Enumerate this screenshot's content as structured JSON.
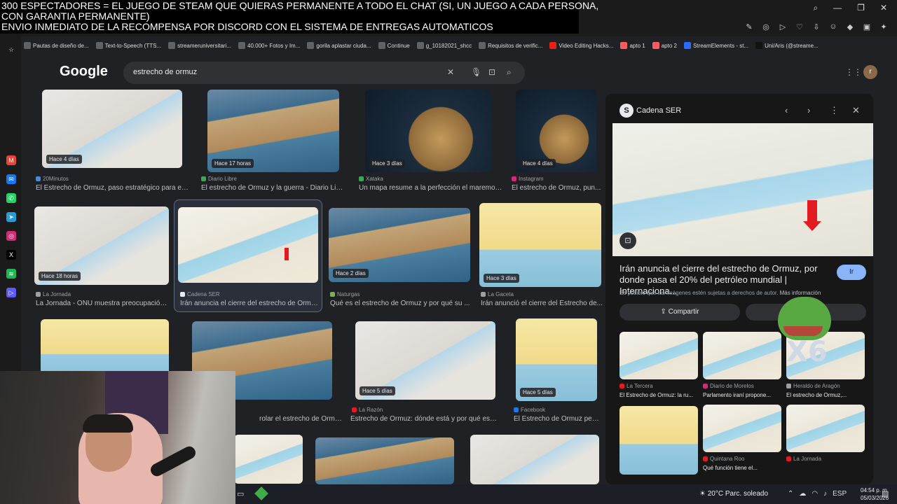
{
  "overlay": {
    "line1": "300 ESPECTADORES = EL JUEGO DE STEAM QUE QUIERAS PERMANENTE A TODO EL CHAT (SI, UN JUEGO A CADA PERSONA,",
    "line2": "CON GARANTIA PERMANENTE)",
    "line3": "ENVIO INMEDIATO DE LA RECOMPENSA POR DISCORD CON EL SISTEMA DE ENTREGAS AUTOMATICOS"
  },
  "bookmarks": [
    "Pautas de diseño de...",
    "Text-to-Speech (TTS...",
    "streameruniversitari...",
    "40.000+ Fotos y Im...",
    "gorila aplastar ciuda...",
    "Continue",
    "g_10182021_shcc",
    "Requisitos de verific...",
    "Video Editing Hacks...",
    "apto 1",
    "apto 2",
    "StreamElements - st...",
    "Uni/Aris (@streame..."
  ],
  "google": {
    "logo": "Google",
    "query": "estrecho de ormuz"
  },
  "results": [
    {
      "badge": "Hace 4 días",
      "source": "20Minutos",
      "title": "El Estrecho de Ormuz, paso estratégico para el ..."
    },
    {
      "badge": "Hace 17 horas",
      "source": "Diario Libre",
      "title": "El estrecho de Ormuz y la guerra - Diario Libre"
    },
    {
      "badge": "Hace 3 días",
      "source": "Xataka",
      "title": "Un mapa resume a la perfección el maremot..."
    },
    {
      "badge": "Hace 4 días",
      "source": "Instagram",
      "title": "El estrecho de Ormuz, pun..."
    },
    {
      "badge": "Hace 18 horas",
      "source": "La Jornada",
      "title": "La Jornada - ONU muestra preocupación..."
    },
    {
      "badge": "",
      "source": "Cadena SER",
      "title": "Irán anuncia el cierre del estrecho de Ormu..."
    },
    {
      "badge": "Hace 2 días",
      "source": "Naturgas",
      "title": "Qué es el estrecho de Ormuz y por qué su ..."
    },
    {
      "badge": "Hace 3 días",
      "source": "La Gaceta",
      "title": "Irán anunció el cierre del Estrecho de..."
    },
    {
      "badge": "",
      "source": "",
      "title": ""
    },
    {
      "badge": "",
      "source": "",
      "title": "rolar el estrecho de Ormuz y se ..."
    },
    {
      "badge": "Hace 5 días",
      "source": "La Razón",
      "title": "Estrecho de Ormuz: dónde está y por qué es un..."
    },
    {
      "badge": "Hace 5 días",
      "source": "Facebook",
      "title": "El Estrecho de Ormuz per..."
    }
  ],
  "panel": {
    "source": "Cadena SER",
    "title": "Irán anuncia el cierre del estrecho de Ormuz, por donde pasa el 20% del petróleo mundial | Internaciona...",
    "visit": "Ir",
    "note": "Es posible que las imágenes estén sujetas a derechos de autor.",
    "more": "Más información",
    "share": "Compartir",
    "related": [
      {
        "source": "La Tercera",
        "title": "El Estrecho de Ormuz: la ru..."
      },
      {
        "source": "Diario de Morelos",
        "title": "Parlamento iraní propone..."
      },
      {
        "source": "Heraldo de Aragón",
        "title": "El estrecho de Ormuz,..."
      },
      {
        "source": "",
        "title": ""
      },
      {
        "source": "Quintana Roo",
        "title": "Qué función tiene el..."
      },
      {
        "source": "La Jornada",
        "title": ""
      }
    ]
  },
  "sticker": {
    "multiplier": "X6"
  },
  "taskbar": {
    "weather": "20°C  Parc. soleado",
    "lang": "ESP",
    "time": "04:54 p. m.",
    "date": "05/03/2026"
  },
  "colors": {
    "accent": "#8ab4f8",
    "page_bg": "#202124",
    "panel_bg": "#171717",
    "arrow": "#e21b22"
  }
}
